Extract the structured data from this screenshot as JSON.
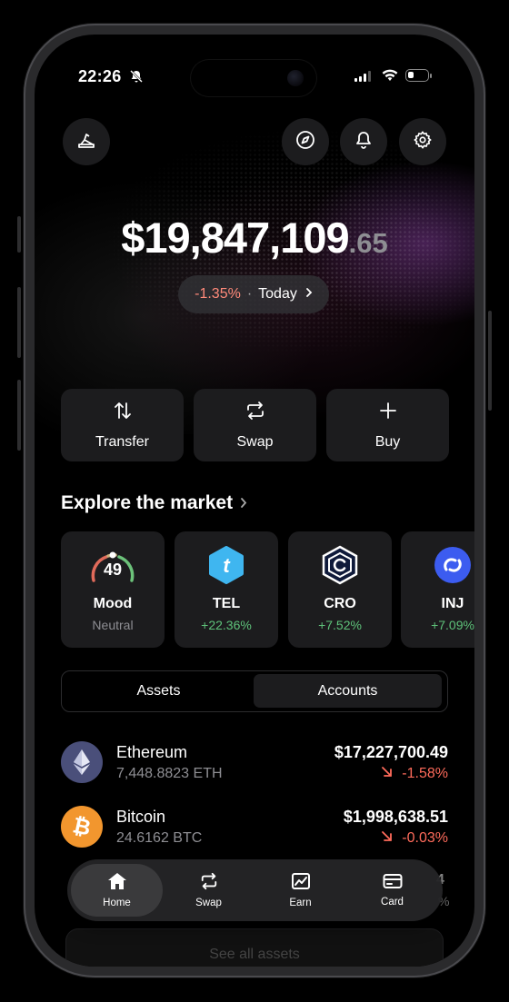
{
  "status": {
    "time": "22:26"
  },
  "header": {
    "left_icon": "wallet-brush-icon",
    "right_icons": [
      "compass-icon",
      "bell-icon",
      "gear-icon"
    ]
  },
  "balance": {
    "whole": "$19,847,109",
    "cents": ".65"
  },
  "change": {
    "percent": "-1.35%",
    "separator": "·",
    "period": "Today"
  },
  "actions": [
    {
      "label": "Transfer",
      "icon": "transfer-arrows-icon"
    },
    {
      "label": "Swap",
      "icon": "swap-icon"
    },
    {
      "label": "Buy",
      "icon": "plus-icon"
    }
  ],
  "explore": {
    "title": "Explore the market",
    "cards": [
      {
        "name": "Mood",
        "sub": "Neutral",
        "gauge_value": "49"
      },
      {
        "name": "TEL",
        "sub": "+22.36%"
      },
      {
        "name": "CRO",
        "sub": "+7.52%"
      },
      {
        "name": "INJ",
        "sub": "+7.09%"
      }
    ]
  },
  "segment": {
    "options": [
      "Assets",
      "Accounts"
    ],
    "selected": "Accounts"
  },
  "assets": [
    {
      "name": "Ethereum",
      "amount": "7,448.8823 ETH",
      "value": "$17,227,700.49",
      "change": "-1.58%"
    },
    {
      "name": "Bitcoin",
      "amount": "24.6162 BTC",
      "value": "$1,998,638.51",
      "change": "-0.03%"
    }
  ],
  "tabbar": {
    "tabs": [
      {
        "label": "Home",
        "icon": "home-icon"
      },
      {
        "label": "Swap",
        "icon": "swap-icon"
      },
      {
        "label": "Earn",
        "icon": "chart-icon"
      },
      {
        "label": "Card",
        "icon": "card-icon"
      }
    ],
    "active": "Home"
  },
  "see_all": "See all assets",
  "colors": {
    "negative": "#ff6b5b",
    "positive": "#5ec27a",
    "card_bg": "#1c1c1e"
  }
}
